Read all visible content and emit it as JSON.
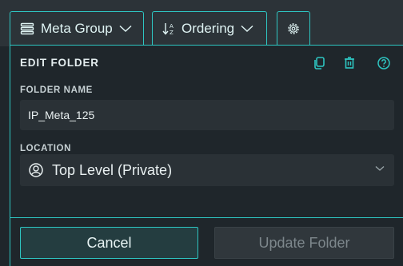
{
  "toolbar": {
    "group_label": "Meta Group",
    "ordering_label": "Ordering"
  },
  "panel": {
    "title": "EDIT FOLDER",
    "folder_name_label": "FOLDER NAME",
    "folder_name_value": "IP_Meta_125",
    "location_label": "LOCATION",
    "location_value": "Top Level (Private)"
  },
  "actions": {
    "cancel_label": "Cancel",
    "update_label": "Update Folder"
  },
  "colors": {
    "accent": "#2ec6c2",
    "background": "#1f262b",
    "field_background": "#2a3136",
    "disabled_text": "#7d878c"
  },
  "icons": [
    "list-icon",
    "sort-icon",
    "chevron-down-icon",
    "gear-icon",
    "copy-icon",
    "trash-icon",
    "help-icon",
    "user-circle-icon"
  ]
}
